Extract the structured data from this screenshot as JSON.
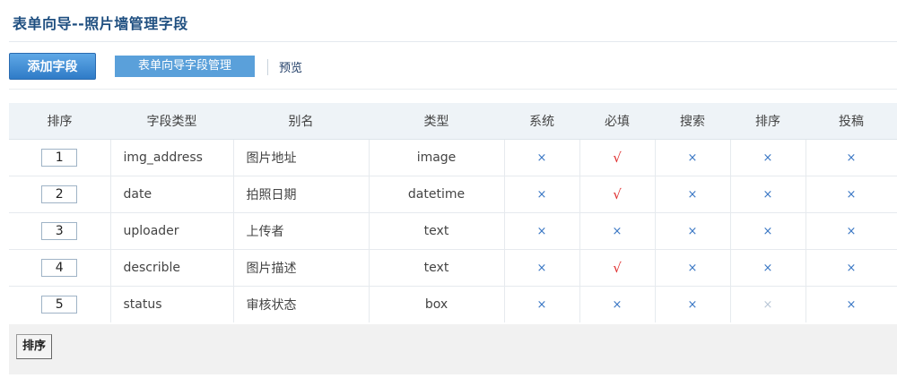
{
  "page": {
    "title": "表单向导--照片墙管理字段"
  },
  "toolbar": {
    "add_field_label": "添加字段",
    "manage_label": "表单向导字段管理",
    "preview_label": "预览"
  },
  "table": {
    "headers": [
      "排序",
      "字段类型",
      "别名",
      "类型",
      "系统",
      "必填",
      "搜索",
      "排序",
      "投稿"
    ],
    "rows": [
      {
        "order": "1",
        "field": "img_address",
        "alias": "图片地址",
        "type": "image",
        "system": "×",
        "required": "√",
        "search": "×",
        "sort": "×",
        "contribute": "×"
      },
      {
        "order": "2",
        "field": "date",
        "alias": "拍照日期",
        "type": "datetime",
        "system": "×",
        "required": "√",
        "search": "×",
        "sort": "×",
        "contribute": "×"
      },
      {
        "order": "3",
        "field": "uploader",
        "alias": "上传者",
        "type": "text",
        "system": "×",
        "required": "×",
        "search": "×",
        "sort": "×",
        "contribute": "×"
      },
      {
        "order": "4",
        "field": "describle",
        "alias": "图片描述",
        "type": "text",
        "system": "×",
        "required": "√",
        "search": "×",
        "sort": "×",
        "contribute": "×"
      },
      {
        "order": "5",
        "field": "status",
        "alias": "审核状态",
        "type": "box",
        "system": "×",
        "required": "×",
        "search": "×",
        "sort": "×",
        "contribute": "×"
      }
    ]
  },
  "footer": {
    "sort_button_label": "排序"
  },
  "colors": {
    "title": "#1f4f80",
    "accent": "#3a7fcb",
    "cross": "#3a77c4",
    "check": "#e03131"
  }
}
